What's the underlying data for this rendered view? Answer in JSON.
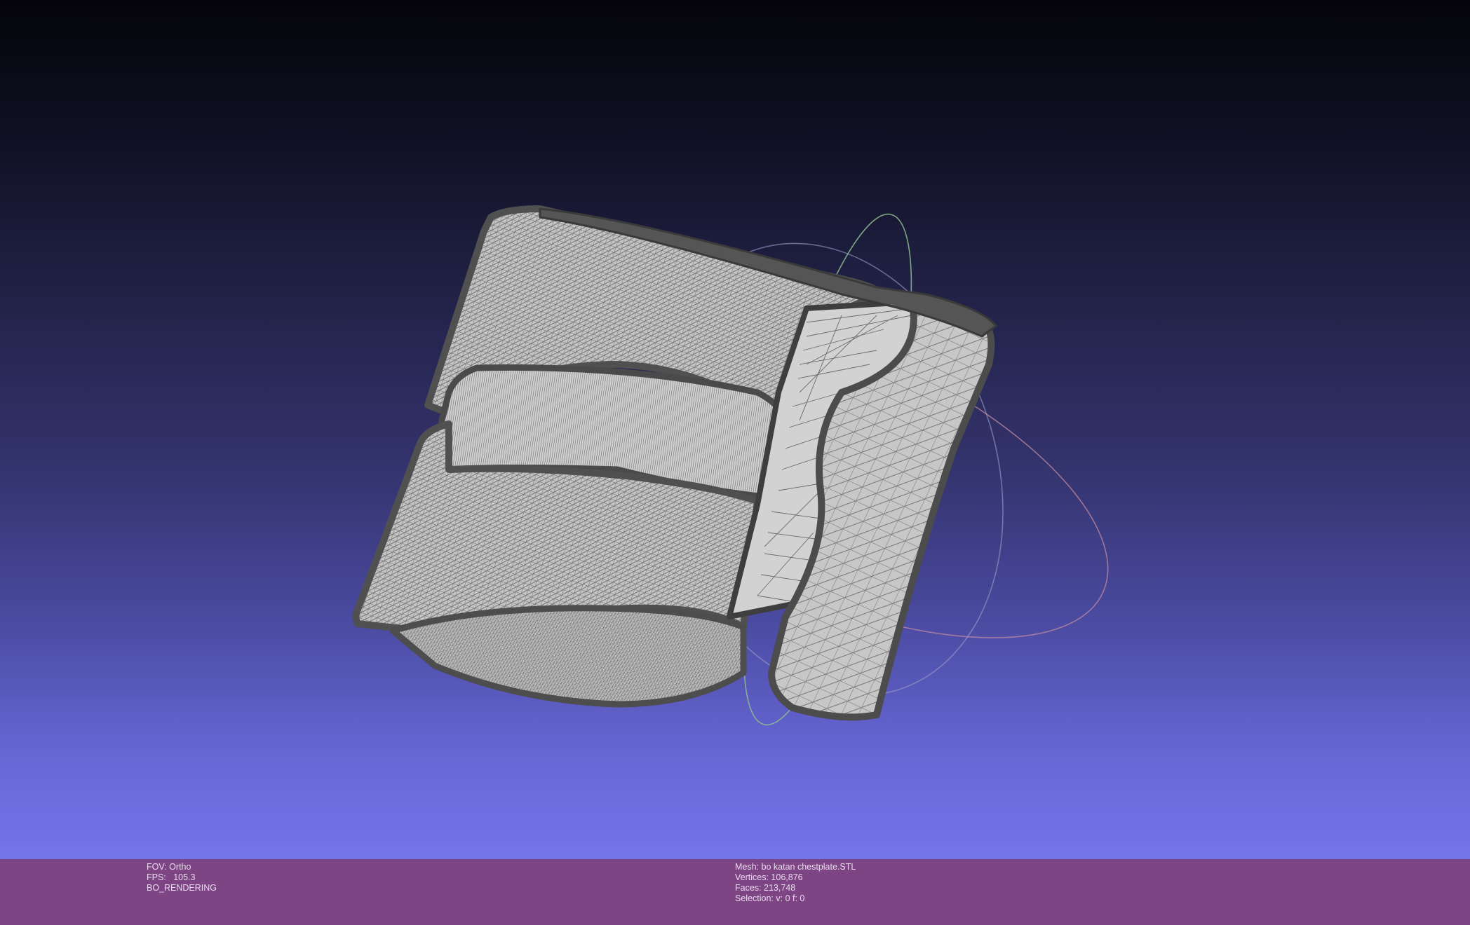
{
  "viewer": {
    "colors": {
      "background_top": "#040409",
      "background_bottom": "#7575ea",
      "info_bar": "#7e4585",
      "mesh_fill": "#c9c9c9",
      "mesh_wire": "#5a5a5a",
      "trackball_green": "#8fbf8f",
      "trackball_red": "#c98f9f"
    }
  },
  "info_left": {
    "fov": "FOV: Ortho",
    "fps": "FPS:   105.3",
    "render_mode": "BO_RENDERING"
  },
  "info_right": {
    "mesh": "Mesh: bo katan chestplate.STL",
    "vertices": "Vertices: 106,876",
    "faces": "Faces: 213,748",
    "selection": "Selection: v: 0 f: 0"
  }
}
